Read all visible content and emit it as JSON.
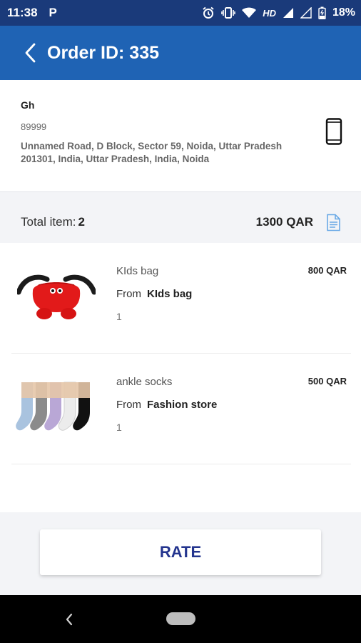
{
  "status_bar": {
    "time": "11:38",
    "notification": "P",
    "network": "HD",
    "battery": "18%"
  },
  "header": {
    "title": "Order ID: 335"
  },
  "address": {
    "name": "Gh",
    "phone": "89999",
    "address": "Unnamed Road, D Block, Sector 59, Noida, Uttar Pradesh 201301, India, Uttar Pradesh, India, Noida"
  },
  "summary": {
    "total_label": "Total item:",
    "total_count": "2",
    "total_amount": "1300 QAR"
  },
  "items": [
    {
      "name": "KIds bag",
      "from_label": "From",
      "store": "KIds bag",
      "quantity": "1",
      "price": "800 QAR"
    },
    {
      "name": "ankle socks",
      "from_label": "From",
      "store": "Fashion store",
      "quantity": "1",
      "price": "500 QAR"
    }
  ],
  "actions": {
    "rate_label": "RATE"
  },
  "colors": {
    "status_bar": "#1a3a7a",
    "app_bar": "#1f63b4",
    "rate_text": "#23348e",
    "invoice_icon": "#6aa9e6"
  },
  "icons": {
    "back": "chevron-left-icon",
    "phone": "smartphone-icon",
    "invoice": "document-icon"
  }
}
